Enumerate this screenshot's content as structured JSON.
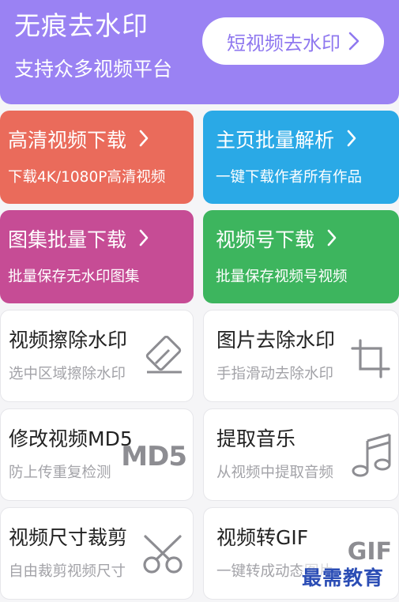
{
  "header": {
    "title": "无痕去水印",
    "subtitle": "支持众多视频平台",
    "pill_label": "短视频去水印"
  },
  "colored_cards": [
    {
      "title": "高清视频下载",
      "subtitle": "下载4K/1080P高清视频",
      "color": "#ea6b5b"
    },
    {
      "title": "主页批量解析",
      "subtitle": "一键下载作者所有作品",
      "color": "#2aa9e6"
    },
    {
      "title": "图集批量下载",
      "subtitle": "批量保存无水印图集",
      "color": "#c64c95"
    },
    {
      "title": "视频号下载",
      "subtitle": "批量保存视频号视频",
      "color": "#3db55e"
    }
  ],
  "tool_cards": [
    {
      "title": "视频擦除水印",
      "subtitle": "选中区域擦除水印",
      "icon": "eraser-icon"
    },
    {
      "title": "图片去除水印",
      "subtitle": "手指滑动去除水印",
      "icon": "crop-icon"
    },
    {
      "title": "修改视频MD5",
      "subtitle": "防上传重复检测",
      "icon": "md5-icon",
      "icon_text": "MD5"
    },
    {
      "title": "提取音乐",
      "subtitle": "从视频中提取音频",
      "icon": "music-note-icon"
    },
    {
      "title": "视频尺寸裁剪",
      "subtitle": "自由裁剪视频尺寸",
      "icon": "scissors-icon"
    },
    {
      "title": "视频转GIF",
      "subtitle": "一键转成动态图片",
      "icon": "gif-icon",
      "icon_text": "GIF"
    }
  ],
  "watermark": "最需教育",
  "chevron": "›"
}
